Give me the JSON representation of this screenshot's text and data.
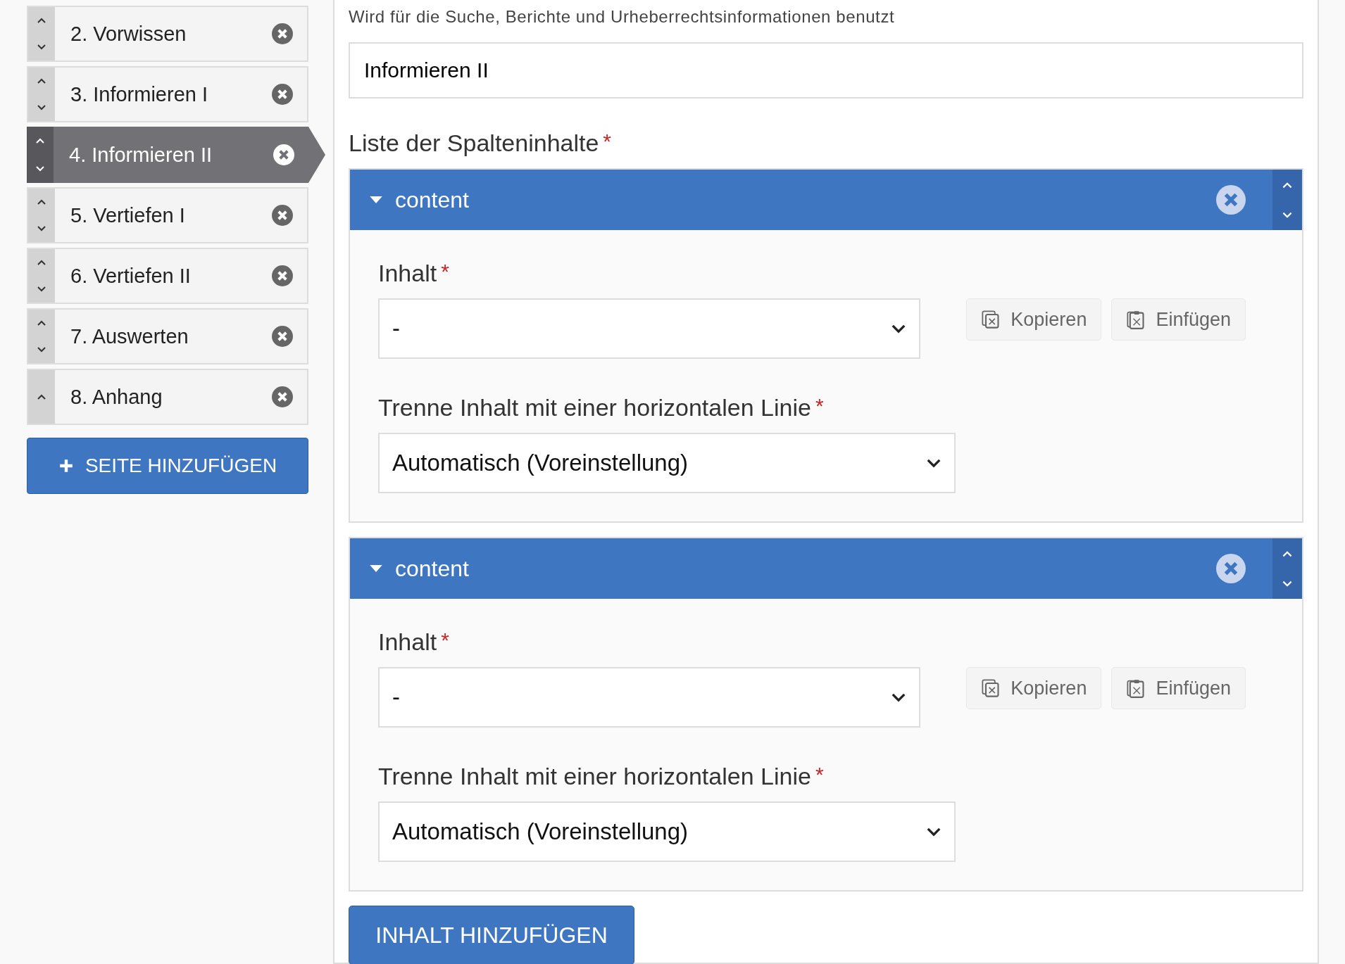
{
  "sidebar": {
    "pages": [
      {
        "label": "2. Vorwissen",
        "selected": false,
        "can_move_down": true
      },
      {
        "label": "3. Informieren I",
        "selected": false,
        "can_move_down": true
      },
      {
        "label": "4. Informieren II",
        "selected": true,
        "can_move_down": true
      },
      {
        "label": "5. Vertiefen I",
        "selected": false,
        "can_move_down": true
      },
      {
        "label": "6. Vertiefen II",
        "selected": false,
        "can_move_down": true
      },
      {
        "label": "7. Auswerten",
        "selected": false,
        "can_move_down": true
      },
      {
        "label": "8. Anhang",
        "selected": false,
        "can_move_down": false
      }
    ],
    "add_button": "SEITE HINZUFÜGEN"
  },
  "main": {
    "help_text": "Wird für die Suche, Berichte und Urheberrechtsinformationen benutzt",
    "title_field": {
      "value": "Informieren II"
    },
    "list_label": {
      "text": "Liste der Spalteninhalte",
      "required_mark": "*"
    },
    "items": [
      {
        "title": "content",
        "expanded": true,
        "content_label": {
          "text": "Inhalt",
          "required_mark": "*"
        },
        "content_value": "-",
        "copy_button": "Kopieren",
        "paste_button": "Einfügen",
        "separator_label": {
          "text": "Trenne Inhalt mit einer horizontalen Linie",
          "required_mark": "*"
        },
        "separator_value": "Automatisch (Voreinstellung)"
      },
      {
        "title": "content",
        "expanded": true,
        "content_label": {
          "text": "Inhalt",
          "required_mark": "*"
        },
        "content_value": "-",
        "copy_button": "Kopieren",
        "paste_button": "Einfügen",
        "separator_label": {
          "text": "Trenne Inhalt mit einer horizontalen Linie",
          "required_mark": "*"
        },
        "separator_value": "Automatisch (Voreinstellung)"
      }
    ],
    "add_button": "INHALT HINZUFÜGEN"
  }
}
